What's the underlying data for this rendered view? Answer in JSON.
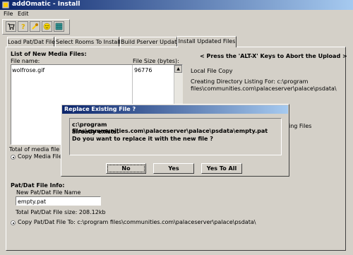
{
  "window": {
    "title": "addOmatic - Install"
  },
  "menu": {
    "file": "File",
    "edit": "Edit"
  },
  "toolbar": {
    "icons": [
      "cart-icon",
      "idea-icon",
      "tools-icon",
      "face-icon",
      "grid-icon"
    ]
  },
  "tabs": [
    {
      "label": "Load Pat/Dat File"
    },
    {
      "label": "Select Rooms To Install"
    },
    {
      "label": "Build Pserver Update"
    },
    {
      "label": "Install Updated Files"
    }
  ],
  "media": {
    "group_title": "List of New Media Files:",
    "col_name": "File name:",
    "col_size": "File Size (bytes):",
    "rows": [
      {
        "name": "wolfrose.gif",
        "size": "96776"
      }
    ],
    "total_label": "Total of media file siz",
    "copy_label": "Copy Media Files"
  },
  "log": {
    "abort_hint": "< Press the 'ALT-X' Keys to Abort the Upload >",
    "line1": "Local File Copy",
    "line2": "Creating Directory Listing For: c:\\program",
    "line3": "files\\communities.com\\palaceserver\\palace\\psdata\\",
    "line4": "ing Files"
  },
  "patdat": {
    "group_title": "Pat/Dat File Info:",
    "new_name_label": "New Pat/Dat File Name",
    "new_name_value": "empty.pat",
    "size_text": "Total Pat/Dat File size: 208.12kb",
    "copy_to": "Copy Pat/Dat File To: c:\\program files\\communities.com\\palaceserver\\palace\\psdata\\"
  },
  "dialog": {
    "title": "Replace Existing File ?",
    "message": [
      "c:\\program files\\communities.com\\palaceserver\\palace\\psdata\\empty.pat",
      "already exists.",
      "Do you want to replace it with the new file ?"
    ],
    "no": "No",
    "yes": "Yes",
    "yes_all": "Yes To All"
  },
  "colors": {
    "title_start": "#0a246a",
    "title_end": "#a6caf0",
    "face": "#d4d0c8"
  }
}
